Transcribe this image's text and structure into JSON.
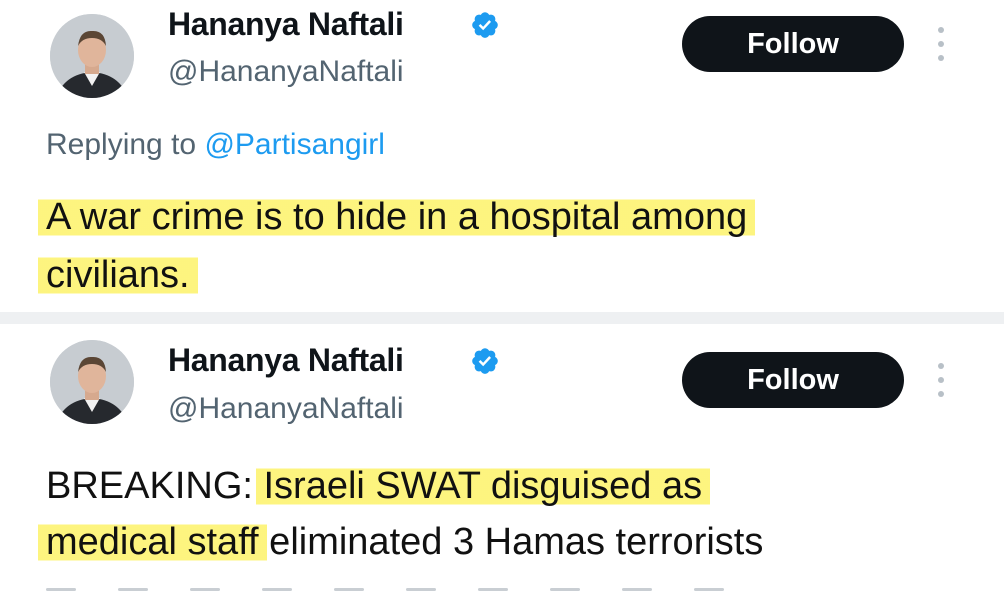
{
  "tweets": [
    {
      "author": "Hananya Naftali",
      "handle": "@HananyaNaftali",
      "follow_label": "Follow",
      "reply_prefix": "Replying to ",
      "reply_to": "@Partisangirl",
      "lines": [
        {
          "text": "A war crime is to hide in a hospital among"
        },
        {
          "text": "civilians."
        }
      ]
    },
    {
      "author": "Hananya Naftali",
      "handle": "@HananyaNaftali",
      "follow_label": "Follow",
      "lines": [
        {
          "pre": "BREAKING: ",
          "highlight": "Israeli SWAT disguised as"
        },
        {
          "highlight": "medical staff",
          "post": " eliminated 3 Hamas terrorists"
        }
      ]
    }
  ],
  "colors": {
    "verified_badge": "#1d9bf0",
    "follow_button": "#0f1419",
    "handle_text": "#536471",
    "mention_link": "#1d9bf0",
    "highlighter": "#fdf478"
  },
  "icons": {
    "verified": "verified-badge-icon",
    "more": "more-options-icon",
    "avatar": "avatar"
  }
}
